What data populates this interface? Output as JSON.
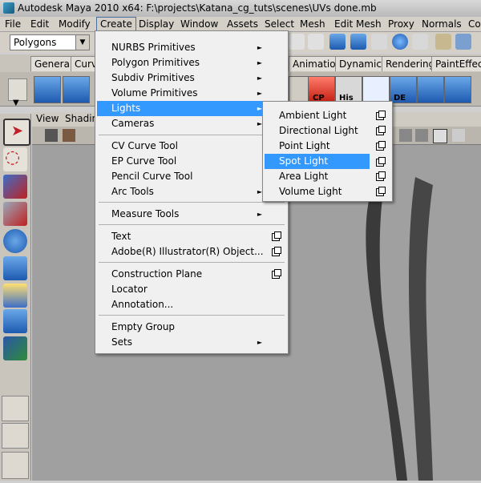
{
  "window": {
    "title": "Autodesk Maya 2010 x64: F:\\projects\\Katana_cg_tuts\\scenes\\UVs done.mb"
  },
  "menubar": [
    "File",
    "Edit",
    "Modify",
    "Create",
    "Display",
    "Window",
    "Assets",
    "Select",
    "Mesh",
    "Edit Mesh",
    "Proxy",
    "Normals",
    "Co"
  ],
  "status_line": {
    "mode": "Polygons"
  },
  "shelf": {
    "tabs": [
      "General",
      "Curve",
      "Animation",
      "Dynamics",
      "Rendering",
      "PaintEffects"
    ],
    "labels": [
      "CP",
      "His",
      "DE"
    ]
  },
  "panel_menu": [
    "View",
    "Shadin"
  ],
  "create_menu": {
    "items": [
      "NURBS Primitives",
      "Polygon Primitives",
      "Subdiv Primitives",
      "Volume Primitives",
      "Lights",
      "Cameras",
      "CV Curve Tool",
      "EP Curve Tool",
      "Pencil Curve Tool",
      "Arc Tools",
      "Measure Tools",
      "Text",
      "Adobe(R) Illustrator(R) Object...",
      "Construction Plane",
      "Locator",
      "Annotation...",
      "Empty Group",
      "Sets"
    ]
  },
  "lights_submenu": {
    "items": [
      "Ambient Light",
      "Directional Light",
      "Point Light",
      "Spot Light",
      "Area Light",
      "Volume Light"
    ],
    "highlighted": "Spot Light"
  },
  "colors": {
    "highlight": "#3399ff",
    "menu_bg": "#f0f0f0",
    "viewport_bg": "#a0a0a0"
  }
}
